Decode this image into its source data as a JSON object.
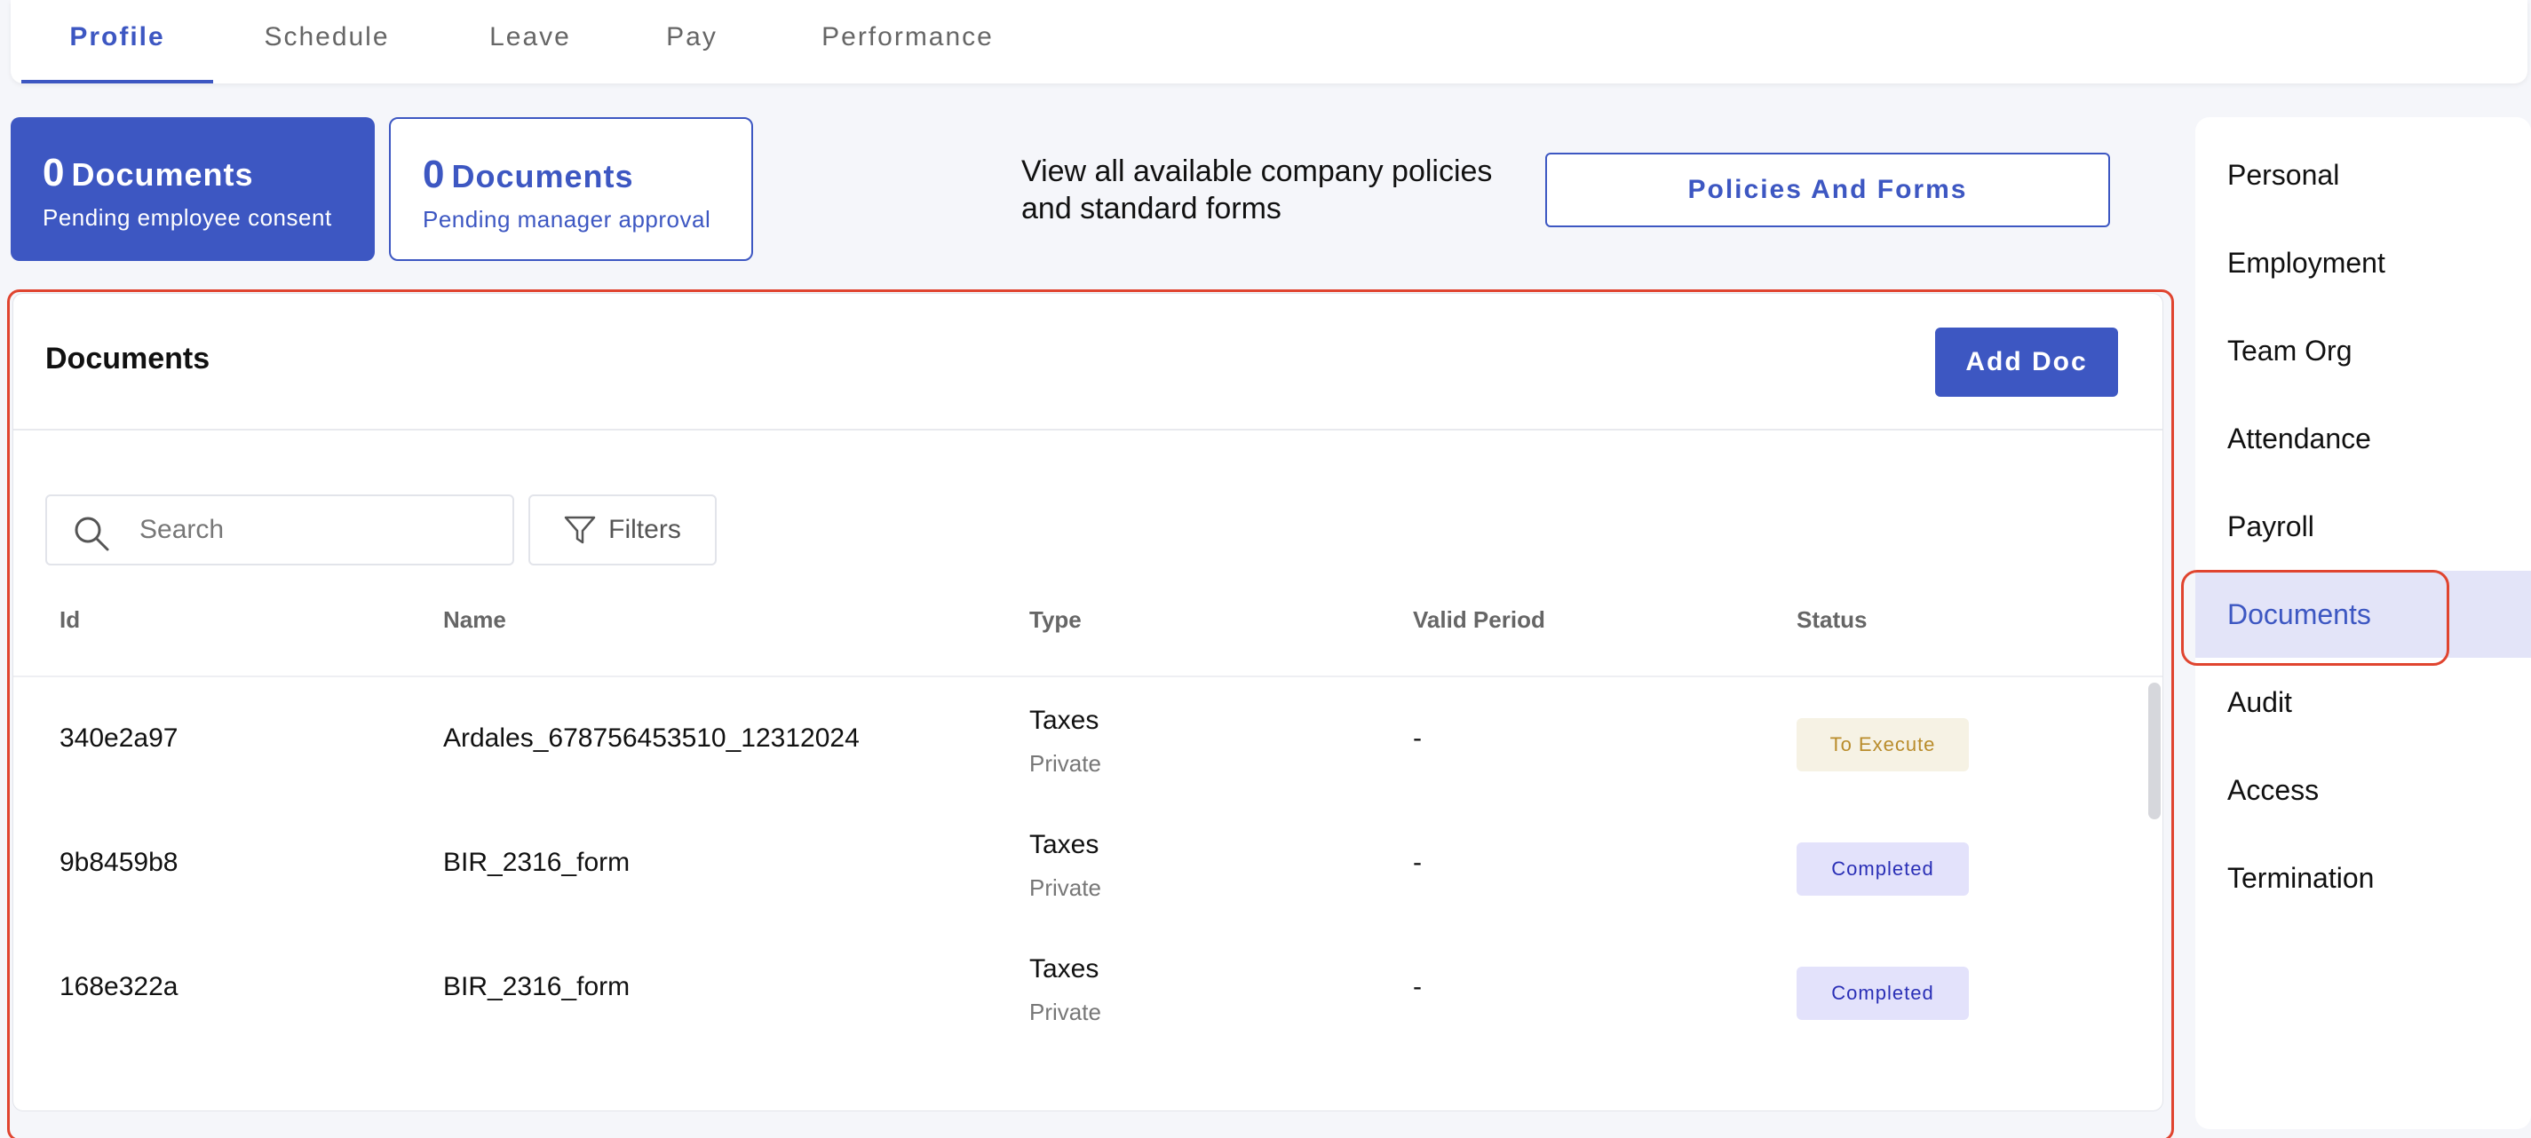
{
  "tabs": [
    {
      "label": "Profile",
      "active": true
    },
    {
      "label": "Schedule",
      "active": false
    },
    {
      "label": "Leave",
      "active": false
    },
    {
      "label": "Pay",
      "active": false
    },
    {
      "label": "Performance",
      "active": false
    }
  ],
  "summary": {
    "consent": {
      "count": "0",
      "label": "Documents",
      "sub": "Pending employee consent"
    },
    "approval": {
      "count": "0",
      "label": "Documents",
      "sub": "Pending manager approval"
    },
    "policies_text": "View all available company policies and standard forms",
    "policies_button": "Policies And Forms"
  },
  "documents": {
    "title": "Documents",
    "add_button": "Add Doc",
    "search_placeholder": "Search",
    "filters_label": "Filters",
    "columns": [
      "Id",
      "Name",
      "Type",
      "Valid Period",
      "Status"
    ],
    "rows": [
      {
        "id": "340e2a97",
        "name": "Ardales_678756453510_12312024",
        "type": "Taxes",
        "visibility": "Private",
        "valid_period": "-",
        "status": "To Execute"
      },
      {
        "id": "9b8459b8",
        "name": "BIR_2316_form",
        "type": "Taxes",
        "visibility": "Private",
        "valid_period": "-",
        "status": "Completed"
      },
      {
        "id": "168e322a",
        "name": "BIR_2316_form",
        "type": "Taxes",
        "visibility": "Private",
        "valid_period": "-",
        "status": "Completed"
      }
    ]
  },
  "sidebar": {
    "items": [
      {
        "label": "Personal"
      },
      {
        "label": "Employment"
      },
      {
        "label": "Team Org"
      },
      {
        "label": "Attendance"
      },
      {
        "label": "Payroll"
      },
      {
        "label": "Documents",
        "active": true
      },
      {
        "label": "Audit"
      },
      {
        "label": "Access"
      },
      {
        "label": "Termination"
      }
    ]
  },
  "colors": {
    "accent": "#3d57c2",
    "highlight": "#e0442f",
    "status_to_execute": "#b98c2b",
    "status_completed": "#2a2fb6"
  },
  "icons": {
    "search": "search-icon",
    "filter": "filter-icon"
  }
}
